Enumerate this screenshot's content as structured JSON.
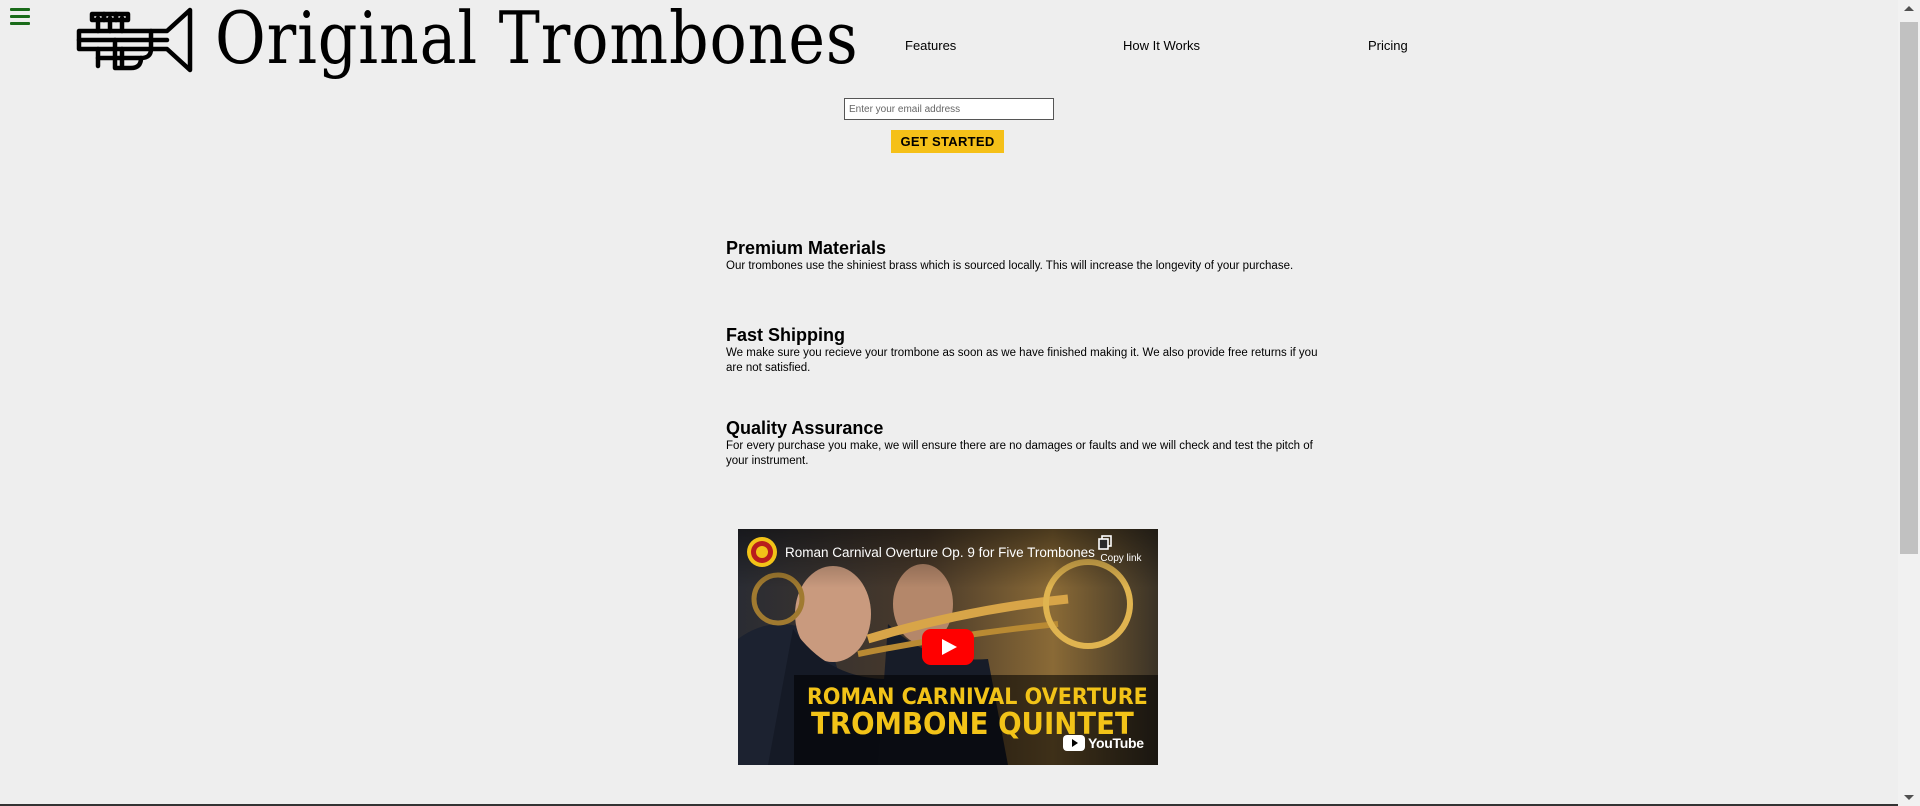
{
  "header": {
    "brand": "Original Trombones",
    "nav": [
      {
        "label": "Features"
      },
      {
        "label": "How It Works"
      },
      {
        "label": "Pricing"
      }
    ]
  },
  "signup": {
    "email_placeholder": "Enter your email address",
    "cta_label": "GET STARTED"
  },
  "features": [
    {
      "title": "Premium Materials",
      "description": "Our trombones use the shiniest brass which is sourced locally. This will increase the longevity of your purchase."
    },
    {
      "title": "Fast Shipping",
      "description": "We make sure you recieve your trombone as soon as we have finished making it. We also provide free returns if you are not satisfied."
    },
    {
      "title": "Quality Assurance",
      "description": "For every purchase you make, we will ensure there are no damages or faults and we will check and test the pitch of your instrument."
    }
  ],
  "video": {
    "title": "Roman Carnival Overture Op. 9 for Five Trombones",
    "copy_link_label": "Copy link",
    "banner_line1": "ROMAN CARNIVAL OVERTURE",
    "banner_line2": "TROMBONE QUINTET",
    "logo_text": "YouTube"
  },
  "icons": {
    "menu": "hamburger-menu-icon",
    "logo": "trumpet-logo-icon",
    "play": "play-icon",
    "copy": "copy-icon"
  },
  "colors": {
    "background": "#eeeeee",
    "menu_icon": "#1a6b1a",
    "cta": "#f5c018",
    "banner_text": "#f2c318",
    "play_button": "#ff0000"
  }
}
